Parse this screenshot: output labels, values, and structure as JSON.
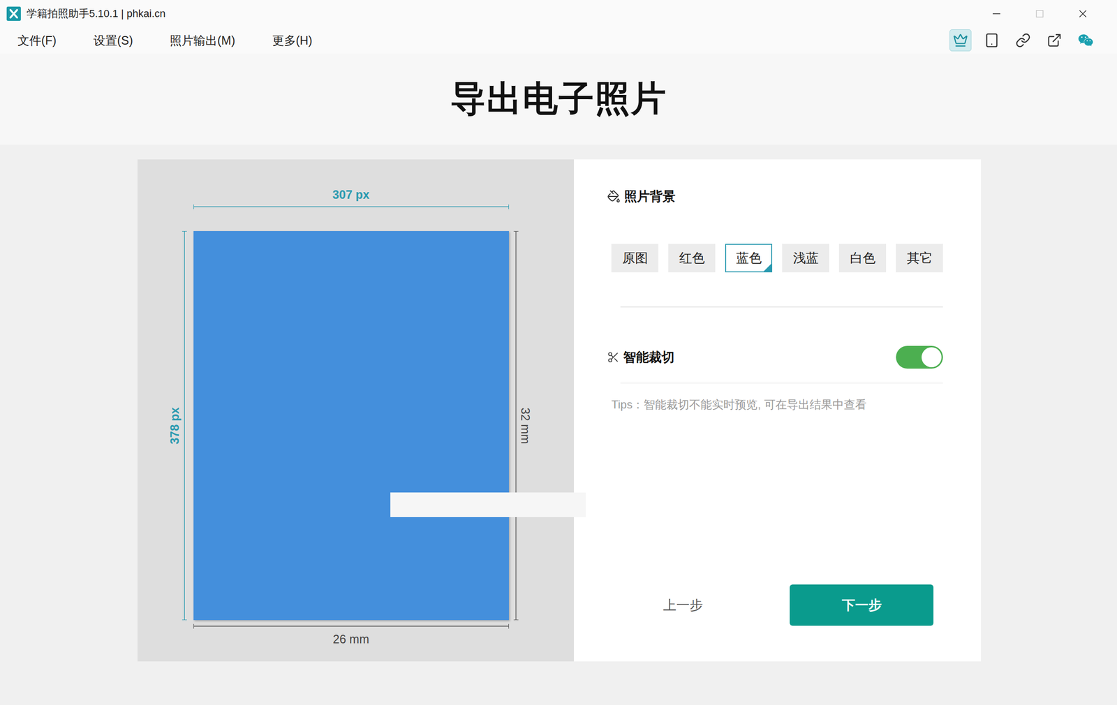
{
  "window": {
    "title": "学籍拍照助手5.10.1 | phkai.cn",
    "maximize_enabled": false
  },
  "menu": [
    {
      "label": "文件(F)"
    },
    {
      "label": "设置(S)"
    },
    {
      "label": "照片输出(M)"
    },
    {
      "label": "更多(H)"
    }
  ],
  "toolbar": [
    {
      "selected": true
    },
    {
      "selected": false
    },
    {
      "selected": false
    },
    {
      "selected": false
    },
    {
      "selected": false
    }
  ],
  "header": {
    "title": "导出电子照片"
  },
  "preview": {
    "width_px": "307 px",
    "height_px": "378 px",
    "width_mm": "26 mm",
    "height_mm": "32 mm"
  },
  "background": {
    "title": "照片背景",
    "options": [
      {
        "label": "原图",
        "selected": false
      },
      {
        "label": "红色",
        "selected": false
      },
      {
        "label": "蓝色",
        "selected": true
      },
      {
        "label": "浅蓝",
        "selected": false
      },
      {
        "label": "白色",
        "selected": false
      },
      {
        "label": "其它",
        "selected": false
      }
    ]
  },
  "smart_crop": {
    "title": "智能裁切",
    "on": true,
    "tips": "Tips：智能裁切不能实时预览, 可在导出结果中查看"
  },
  "buttons": [
    {
      "label": "上一步",
      "kind": "text"
    },
    {
      "label": "下一步",
      "kind": "primary"
    }
  ]
}
